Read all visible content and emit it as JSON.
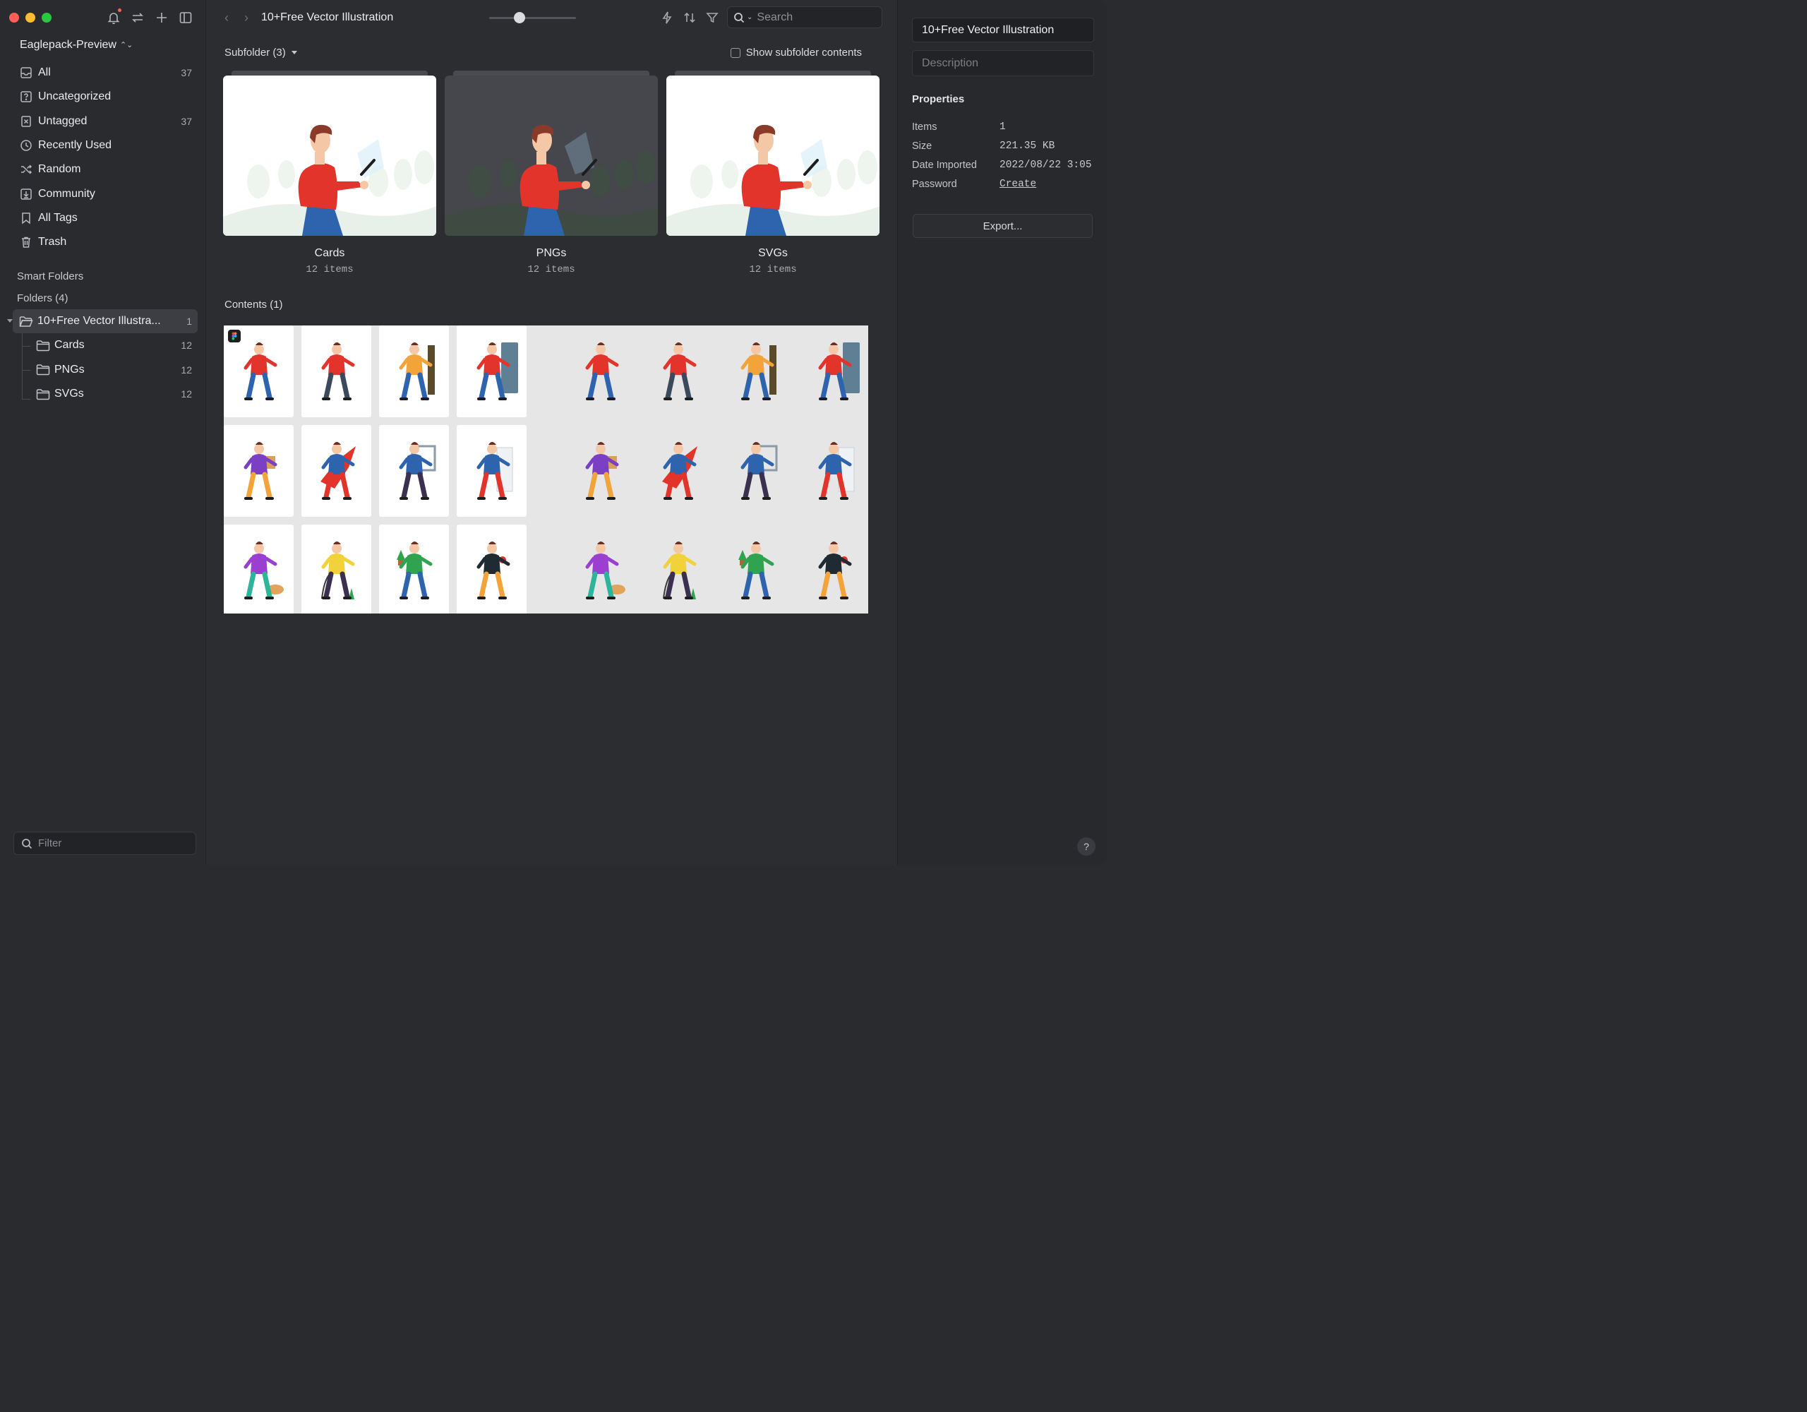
{
  "sidebar": {
    "library": "Eaglepack-Preview",
    "nav": [
      {
        "label": "All",
        "count": "37",
        "icon": "inbox-icon"
      },
      {
        "label": "Uncategorized",
        "count": "",
        "icon": "question-box-icon"
      },
      {
        "label": "Untagged",
        "count": "37",
        "icon": "untagged-icon"
      },
      {
        "label": "Recently Used",
        "count": "",
        "icon": "clock-icon"
      },
      {
        "label": "Random",
        "count": "",
        "icon": "shuffle-icon"
      },
      {
        "label": "Community",
        "count": "",
        "icon": "download-box-icon"
      },
      {
        "label": "All Tags",
        "count": "",
        "icon": "bookmark-icon"
      },
      {
        "label": "Trash",
        "count": "",
        "icon": "trash-icon"
      }
    ],
    "smart_folders": "Smart Folders",
    "folders_title": "Folders (4)",
    "folders": [
      {
        "label": "10+Free Vector Illustra...",
        "count": "1"
      },
      {
        "label": "Cards",
        "count": "12"
      },
      {
        "label": "PNGs",
        "count": "12"
      },
      {
        "label": "SVGs",
        "count": "12"
      }
    ],
    "filter_placeholder": "Filter"
  },
  "toolbar": {
    "title": "10+Free Vector Illustration",
    "search_placeholder": "Search",
    "zoom_fraction": 0.35
  },
  "main": {
    "subfolder_header": "Subfolder (3)",
    "show_subfolder": "Show subfolder contents",
    "subfolders": [
      {
        "name": "Cards",
        "count": "12 items",
        "theme": "light"
      },
      {
        "name": "PNGs",
        "count": "12 items",
        "theme": "dark"
      },
      {
        "name": "SVGs",
        "count": "12 items",
        "theme": "light"
      }
    ],
    "contents_header": "Contents (1)"
  },
  "inspector": {
    "title": "10+Free Vector Illustration",
    "description_placeholder": "Description",
    "properties_title": "Properties",
    "properties": [
      {
        "key": "Items",
        "value": "1"
      },
      {
        "key": "Size",
        "value": "221.35 KB"
      },
      {
        "key": "Date Imported",
        "value": "2022/08/22 3:05"
      },
      {
        "key": "Password",
        "value": "Create"
      }
    ],
    "export_label": "Export...",
    "help_label": "?"
  },
  "colors": {
    "accent_red": "#ff5f57",
    "accent_yellow": "#febc2e",
    "accent_green": "#28c840",
    "sidebar_bg": "#2a2b2f",
    "main_bg": "#2c2d31"
  }
}
